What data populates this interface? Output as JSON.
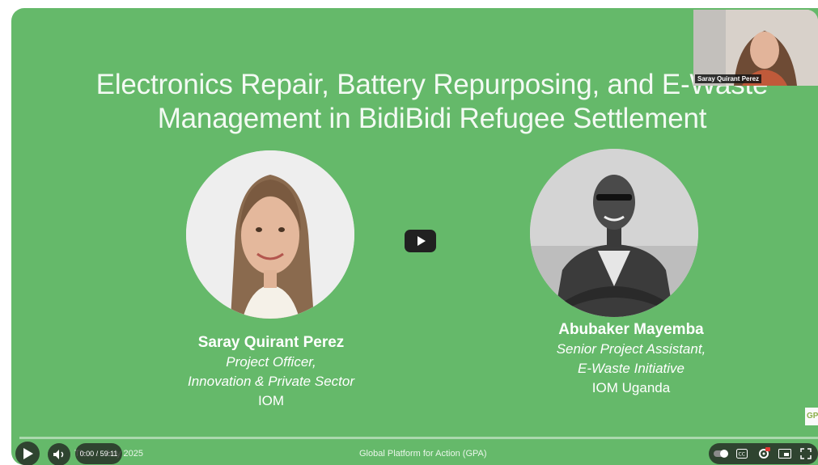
{
  "slide": {
    "title_line1": "Electronics Repair, Battery Repurposing, and E-Waste",
    "title_line2": "Management in BidiBidi Refugee Settlement"
  },
  "speakers": [
    {
      "name": "Saray Quirant Perez",
      "role_line1": "Project Officer,",
      "role_line2": "Innovation & Private Sector",
      "org": "IOM"
    },
    {
      "name": "Abubaker Mayemba",
      "role_line1": "Senior Project Assistant,",
      "role_line2": "E-Waste Initiative",
      "org": "IOM Uganda"
    }
  ],
  "pip": {
    "participant_name": "Saray Quirant Perez"
  },
  "footer": {
    "date_text": "Th… …July 2025",
    "center_text": "Global Platform for Action (GPA)",
    "logo_text": "GP"
  },
  "controls": {
    "time": "0:00 / 59:11",
    "progress_fraction": 0.0
  },
  "colors": {
    "slide_bg": "#65b96a",
    "control_bg": "#1e1e1e"
  }
}
